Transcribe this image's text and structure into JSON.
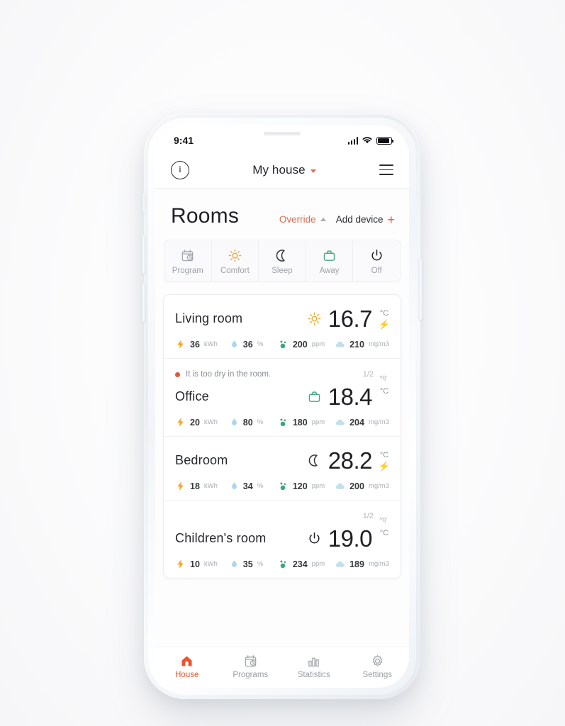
{
  "status_bar": {
    "time": "9:41",
    "icons": [
      "cellular-signal-icon",
      "wifi-icon",
      "battery-icon"
    ]
  },
  "app_bar": {
    "info_label": "i",
    "title": "My house",
    "chevron": "chevron-down-icon",
    "menu": "hamburger-menu-icon"
  },
  "page": {
    "title": "Rooms",
    "override_label": "Override",
    "add_device_label": "Add device",
    "add_device_plus": "+"
  },
  "modes": [
    {
      "label": "Program",
      "icon": "calendar-clock-icon",
      "color": "#a2a7ad"
    },
    {
      "label": "Comfort",
      "icon": "sun-icon",
      "color": "#f0a830"
    },
    {
      "label": "Sleep",
      "icon": "moon-icon",
      "color": "#33363a"
    },
    {
      "label": "Away",
      "icon": "briefcase-icon",
      "color": "#4aa883"
    },
    {
      "label": "Off",
      "icon": "power-icon",
      "color": "#1f2124"
    }
  ],
  "rooms": [
    {
      "name": "Living room",
      "mode_icon": "sun-icon",
      "mode_color": "#f0a830",
      "temperature": "16.7",
      "unit": "°C",
      "heating": true,
      "alert": null,
      "signal": null,
      "metrics": [
        {
          "icon": "bolt-icon",
          "value": "36",
          "unit": "kWh"
        },
        {
          "icon": "droplet-icon",
          "value": "36",
          "unit": "%"
        },
        {
          "icon": "co2-icon",
          "value": "200",
          "unit": "ppm"
        },
        {
          "icon": "cloud-icon",
          "value": "210",
          "unit": "mg/m3"
        }
      ]
    },
    {
      "name": "Office",
      "mode_icon": "briefcase-icon",
      "mode_color": "#4aa883",
      "temperature": "18.4",
      "unit": "°C",
      "heating": false,
      "alert": "It is too dry in the room.",
      "signal": "1/2",
      "metrics": [
        {
          "icon": "bolt-icon",
          "value": "20",
          "unit": "kWh"
        },
        {
          "icon": "droplet-icon",
          "value": "80",
          "unit": "%"
        },
        {
          "icon": "co2-icon",
          "value": "180",
          "unit": "ppm"
        },
        {
          "icon": "cloud-icon",
          "value": "204",
          "unit": "mg/m3"
        }
      ]
    },
    {
      "name": "Bedroom",
      "mode_icon": "moon-icon",
      "mode_color": "#33363a",
      "temperature": "28.2",
      "unit": "°C",
      "heating": true,
      "alert": null,
      "signal": null,
      "metrics": [
        {
          "icon": "bolt-icon",
          "value": "18",
          "unit": "kWh"
        },
        {
          "icon": "droplet-icon",
          "value": "34",
          "unit": "%"
        },
        {
          "icon": "co2-icon",
          "value": "120",
          "unit": "ppm"
        },
        {
          "icon": "cloud-icon",
          "value": "200",
          "unit": "mg/m3"
        }
      ]
    },
    {
      "name": "Children's room",
      "mode_icon": "power-icon",
      "mode_color": "#1f2124",
      "temperature": "19.0",
      "unit": "°C",
      "heating": false,
      "alert": null,
      "signal": "1/2",
      "metrics": [
        {
          "icon": "bolt-icon",
          "value": "10",
          "unit": "kWh"
        },
        {
          "icon": "droplet-icon",
          "value": "35",
          "unit": "%"
        },
        {
          "icon": "co2-icon",
          "value": "234",
          "unit": "ppm"
        },
        {
          "icon": "cloud-icon",
          "value": "189",
          "unit": "mg/m3"
        }
      ]
    }
  ],
  "tabs": [
    {
      "label": "House",
      "icon": "home-icon",
      "active": true
    },
    {
      "label": "Programs",
      "icon": "calendar-clock-icon",
      "active": false
    },
    {
      "label": "Statistics",
      "icon": "bar-chart-icon",
      "active": false
    },
    {
      "label": "Settings",
      "icon": "gear-icon",
      "active": false
    }
  ],
  "colors": {
    "accent": "#e8552f",
    "override": "#e06a4e",
    "heating_bolt": "#ed4b2a",
    "energy": "#f5a623",
    "humidity": "#a8d8ea",
    "co2": "#3aa87a",
    "air": "#bfe0ed",
    "muted": "#9aa0a6"
  }
}
